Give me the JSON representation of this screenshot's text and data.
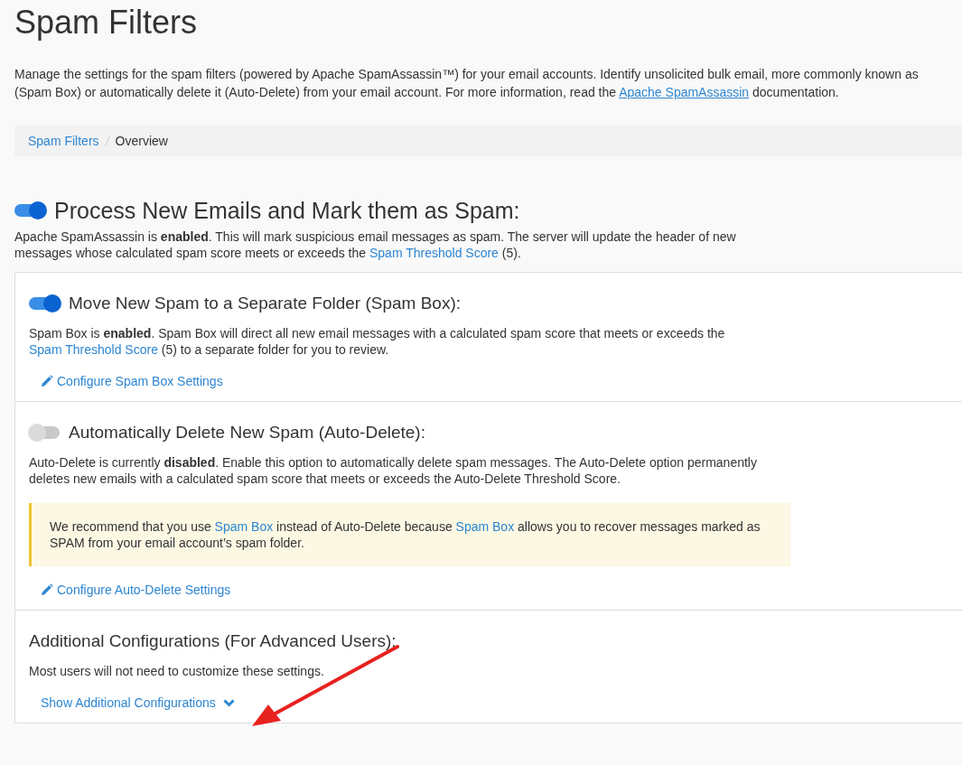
{
  "page_title": "Spam Filters",
  "intro_lines": [
    [
      {
        "kind": "text",
        "text": "Manage the settings for the spam filters (powered by Apache SpamAssassin™) for your email accounts. Identify unsolicited bulk email, more commonly known as"
      }
    ],
    [
      {
        "kind": "text",
        "text": "(Spam Box) or automatically delete it (Auto-Delete) from your email account. For more information, read the "
      },
      {
        "kind": "link",
        "text": "Apache SpamAssassin"
      },
      {
        "kind": "text",
        "text": " documentation."
      }
    ]
  ],
  "breadcrumb": [
    {
      "label": "Spam Filters",
      "selected": false
    },
    {
      "label": "Overview",
      "selected": true
    }
  ],
  "main_setting": {
    "title": "Process New Emails and Mark them as Spam:",
    "on": true,
    "description": [
      {
        "kind": "text",
        "text": "Apache SpamAssassin is "
      },
      {
        "kind": "bold",
        "text": "enabled"
      },
      {
        "kind": "text",
        "text": ". This will mark suspicious email messages as spam. The server will update the header of new messages whose calculated spam score meets or exceeds the "
      },
      {
        "kind": "link",
        "text": "Spam Threshold Score"
      },
      {
        "kind": "text",
        "text": " (5)."
      }
    ]
  },
  "panels": [
    {
      "kind": "toggle",
      "title": "Move New Spam to a Separate Folder (Spam Box):",
      "on": true,
      "description": [
        {
          "kind": "text",
          "text": "Spam Box is "
        },
        {
          "kind": "bold",
          "text": "enabled"
        },
        {
          "kind": "text",
          "text": ". Spam Box will direct all new email messages with a calculated spam score that meets or exceeds the "
        },
        {
          "kind": "link",
          "text": "Spam Threshold Score"
        },
        {
          "kind": "text",
          "text": " (5) to a separate folder for you to review."
        }
      ],
      "action": {
        "label": "Configure Spam Box Settings",
        "kind": "edit"
      }
    },
    {
      "kind": "toggle",
      "title": "Automatically Delete New Spam (Auto-Delete):",
      "on": false,
      "description": [
        {
          "kind": "text",
          "text": "Auto-Delete is currently "
        },
        {
          "kind": "bold",
          "text": "disabled"
        },
        {
          "kind": "text",
          "text": ". Enable this option to automatically delete spam messages. The Auto-Delete option permanently deletes new emails with a calculated spam score that meets or exceeds the Auto-Delete Threshold Score."
        }
      ],
      "alert": [
        {
          "kind": "text",
          "text": "We recommend that you use "
        },
        {
          "kind": "link",
          "text": "Spam Box"
        },
        {
          "kind": "text",
          "text": " instead of Auto-Delete because "
        },
        {
          "kind": "link",
          "text": "Spam Box"
        },
        {
          "kind": "text",
          "text": " allows you to recover messages marked as SPAM from your email account’s spam folder."
        }
      ],
      "action": {
        "label": "Configure Auto-Delete Settings",
        "kind": "edit"
      }
    },
    {
      "kind": "plain",
      "title": "Additional Configurations (For Advanced Users):",
      "description": [
        {
          "kind": "text",
          "text": "Most users will not need to customize these settings."
        }
      ],
      "action": {
        "label": "Show Additional Configurations",
        "kind": "expand"
      }
    }
  ]
}
